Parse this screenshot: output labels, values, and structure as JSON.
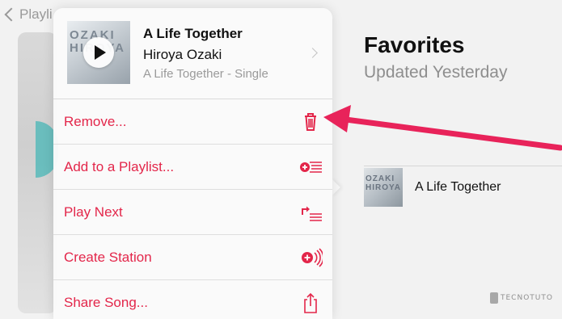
{
  "nav": {
    "back_label": "Playli"
  },
  "playlist": {
    "title": "Favorites",
    "subtitle": "Updated Yesterday"
  },
  "track_list": [
    {
      "title": "A Life Together",
      "art_text": "OZAKI HIROYA"
    }
  ],
  "song": {
    "title": "A Life Together",
    "artist": "Hiroya Ozaki",
    "album": "A Life Together - Single",
    "art_text": "OZAKI HIROYA"
  },
  "menu": {
    "items": [
      {
        "label": "Remove...",
        "icon": "trash-icon"
      },
      {
        "label": "Add to a Playlist...",
        "icon": "add-to-playlist-icon"
      },
      {
        "label": "Play Next",
        "icon": "play-next-icon"
      },
      {
        "label": "Create Station",
        "icon": "create-station-icon"
      },
      {
        "label": "Share Song...",
        "icon": "share-icon"
      }
    ]
  },
  "watermark": {
    "text": "TECNOTUTO"
  },
  "colors": {
    "accent": "#e3264a",
    "annotation_arrow": "#e8235a",
    "secondary_text": "#8e8e8e"
  }
}
